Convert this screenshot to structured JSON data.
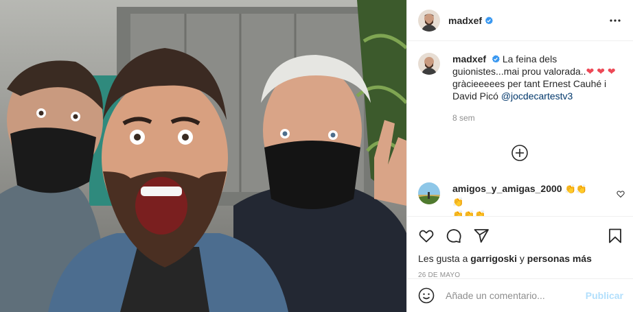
{
  "post": {
    "username": "madxef",
    "caption_start": "La feina dels guionistes...mai prou valorada..",
    "caption_mid": " gràcieeeees per tant Ernest Cauhé i David Picó ",
    "caption_mention": "@jocdecartestv3",
    "time_ago": "8 sem"
  },
  "comment": {
    "username": "amigos_y_amigas_2000",
    "emoji_first_line": "👏👏👏",
    "emoji_second_line": "👏👏👏"
  },
  "likes": {
    "prefix": "Les gusta a ",
    "user": "garrigoski",
    "joiner": " y ",
    "others": "personas más"
  },
  "date": "26 DE MAYO",
  "add_comment": {
    "placeholder": "Añade un comentario...",
    "publish_label": "Publicar"
  },
  "colors": {
    "verified": "#3897f0",
    "heart": "#ed4956",
    "mention": "#00376b",
    "publish_disabled": "#b2dffc"
  },
  "icons": [
    "more-options-icon",
    "verified-badge-icon",
    "load-more-icon",
    "like-icon",
    "comment-icon",
    "share-icon",
    "save-icon",
    "emoji-icon",
    "heart-icon"
  ]
}
